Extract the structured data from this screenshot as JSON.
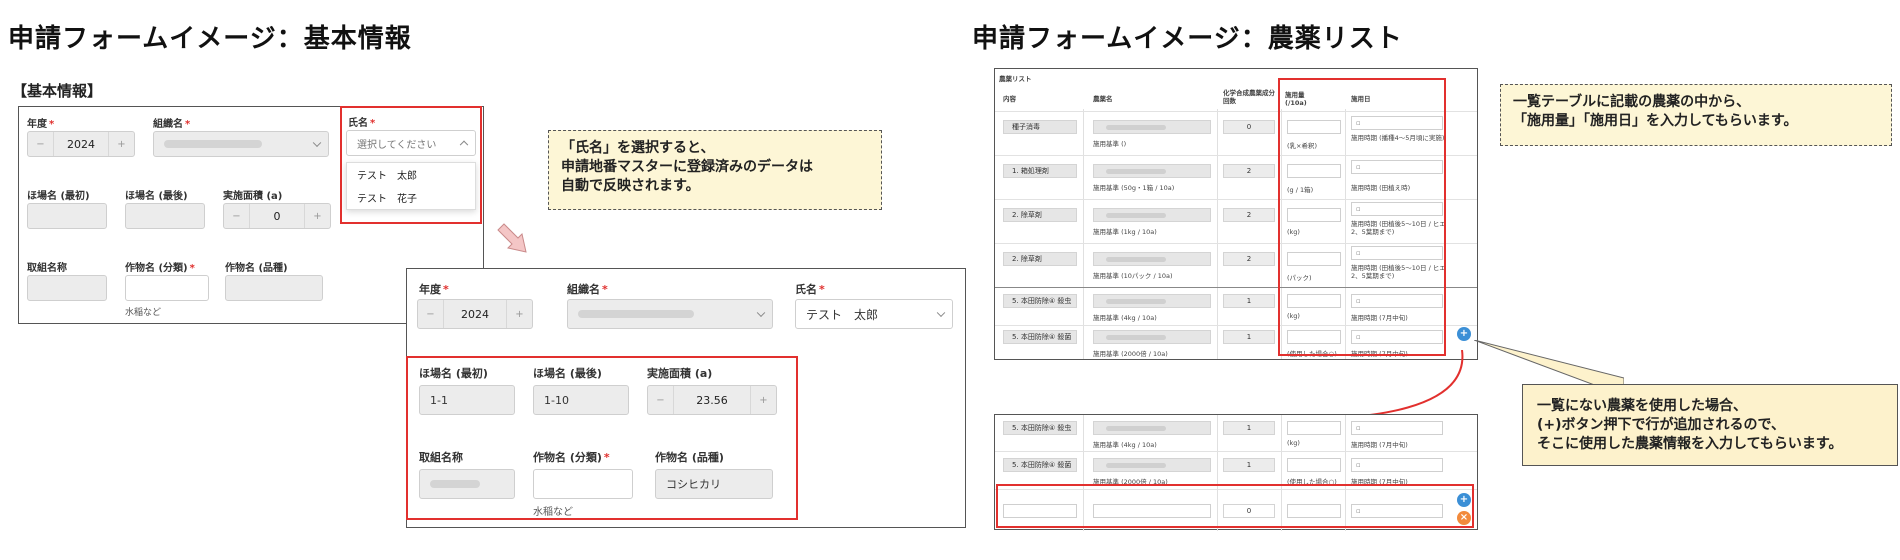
{
  "left_title": "申請フォームイメージ：基本情報",
  "right_title": "申請フォームイメージ：農薬リスト",
  "section_label": "【基本情報】",
  "form1": {
    "year_label": "年度",
    "year_value": "2024",
    "org_label": "組織名",
    "name_label": "氏名",
    "name_placeholder": "選択してください",
    "name_options": [
      "テスト　太郎",
      "テスト　花子"
    ],
    "field_first_label": "ほ場名 (最初)",
    "field_last_label": "ほ場名 (最後)",
    "area_label": "実施面積 (a)",
    "area_value": "0",
    "program_label": "取組名称",
    "crop_class_label": "作物名 (分類)",
    "crop_variety_label": "作物名 (品種)",
    "crop_hint": "水稲など"
  },
  "form2": {
    "year_label": "年度",
    "year_value": "2024",
    "org_label": "組織名",
    "name_label": "氏名",
    "name_value": "テスト　太郎",
    "field_first_label": "ほ場名 (最初)",
    "field_first_value": "1-1",
    "field_last_label": "ほ場名 (最後)",
    "field_last_value": "1-10",
    "area_label": "実施面積 (a)",
    "area_value": "23.56",
    "program_label": "取組名称",
    "crop_class_label": "作物名 (分類)",
    "crop_variety_label": "作物名 (品種)",
    "crop_variety_value": "コシヒカリ",
    "crop_hint": "水稲など"
  },
  "note1": [
    "「氏名」を選択すると、",
    "申請地番マスターに登録済みのデータは",
    "自動で反映されます。"
  ],
  "note2": [
    "一覧テーブルに記載の農薬の中から、",
    "「施用量」「施用日」を入力してもらいます。"
  ],
  "note3": [
    "一覧にない農薬を使用した場合、",
    "(+)ボタン押下で行が追加されるので、",
    "そこに使用した農薬情報を入力してもらいます。"
  ],
  "pesticide_table": {
    "caption": "農薬リスト",
    "headers": [
      "内容",
      "農薬名",
      "化学合成農薬成分回数",
      "施用量\n(/10a)",
      "施用日"
    ],
    "rows": [
      {
        "content": "種子消毒",
        "standard": "施用基準 ()",
        "count": "0",
        "unit": "(乳×希釈)",
        "date_note": "施用時期 (播種4～5月頃に実施)"
      },
      {
        "content": "1. 箱処理剤",
        "standard": "施用基準 (50g・1箱 / 10a)",
        "count": "2",
        "unit": "(g / 1箱)",
        "date_note": "施用時期 (田植え時)"
      },
      {
        "content": "2. 除草剤",
        "standard": "施用基準 (1kg / 10a)",
        "count": "2",
        "unit": "(kg)",
        "date_note": "施用時期 (田植後5～10日 / ヒエ2、5葉期まで)"
      },
      {
        "content": "2. 除草剤",
        "standard": "施用基準 (10パック / 10a)",
        "count": "2",
        "unit": "(パック)",
        "date_note": "施用時期 (田植後5～10日 / ヒエ2、5葉期まで)"
      },
      {
        "content": "5. 本田防除④ 殺虫",
        "standard": "施用基準 (4kg / 10a)",
        "count": "1",
        "unit": "(kg)",
        "date_note": "施用時期 (7月中旬)"
      },
      {
        "content": "5. 本田防除④ 殺菌",
        "standard": "施用基準 (2000倍 / 10a)",
        "count": "1",
        "unit": "(使用した場合○)",
        "date_note": "施用時期 (7月中旬)"
      }
    ]
  },
  "added_table": {
    "rows": [
      {
        "content": "5. 本田防除④ 殺虫",
        "standard": "施用基準 (4kg / 10a)",
        "count": "1",
        "unit": "(kg)",
        "date_note": "施用時期 (7月中旬)"
      },
      {
        "content": "5. 本田防除④ 殺菌",
        "standard": "施用基準 (2000倍 / 10a)",
        "count": "1",
        "unit": "(使用した場合○)",
        "date_note": "施用時期 (7月中旬)"
      }
    ],
    "new_row_count": "0"
  },
  "colors": {
    "accent_red": "#e2302e",
    "add_button": "#3b8fd6",
    "remove_button": "#f28a3c",
    "note_bg": "#fdf6d6"
  }
}
